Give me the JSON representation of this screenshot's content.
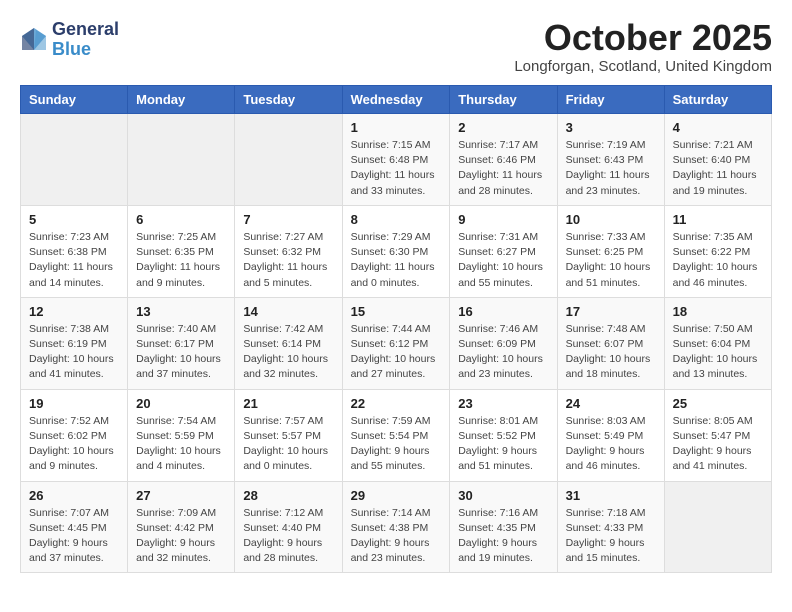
{
  "logo": {
    "general": "General",
    "blue": "Blue"
  },
  "title": "October 2025",
  "location": "Longforgan, Scotland, United Kingdom",
  "days_of_week": [
    "Sunday",
    "Monday",
    "Tuesday",
    "Wednesday",
    "Thursday",
    "Friday",
    "Saturday"
  ],
  "weeks": [
    [
      {
        "day": "",
        "info": ""
      },
      {
        "day": "",
        "info": ""
      },
      {
        "day": "",
        "info": ""
      },
      {
        "day": "1",
        "info": "Sunrise: 7:15 AM\nSunset: 6:48 PM\nDaylight: 11 hours and 33 minutes."
      },
      {
        "day": "2",
        "info": "Sunrise: 7:17 AM\nSunset: 6:46 PM\nDaylight: 11 hours and 28 minutes."
      },
      {
        "day": "3",
        "info": "Sunrise: 7:19 AM\nSunset: 6:43 PM\nDaylight: 11 hours and 23 minutes."
      },
      {
        "day": "4",
        "info": "Sunrise: 7:21 AM\nSunset: 6:40 PM\nDaylight: 11 hours and 19 minutes."
      }
    ],
    [
      {
        "day": "5",
        "info": "Sunrise: 7:23 AM\nSunset: 6:38 PM\nDaylight: 11 hours and 14 minutes."
      },
      {
        "day": "6",
        "info": "Sunrise: 7:25 AM\nSunset: 6:35 PM\nDaylight: 11 hours and 9 minutes."
      },
      {
        "day": "7",
        "info": "Sunrise: 7:27 AM\nSunset: 6:32 PM\nDaylight: 11 hours and 5 minutes."
      },
      {
        "day": "8",
        "info": "Sunrise: 7:29 AM\nSunset: 6:30 PM\nDaylight: 11 hours and 0 minutes."
      },
      {
        "day": "9",
        "info": "Sunrise: 7:31 AM\nSunset: 6:27 PM\nDaylight: 10 hours and 55 minutes."
      },
      {
        "day": "10",
        "info": "Sunrise: 7:33 AM\nSunset: 6:25 PM\nDaylight: 10 hours and 51 minutes."
      },
      {
        "day": "11",
        "info": "Sunrise: 7:35 AM\nSunset: 6:22 PM\nDaylight: 10 hours and 46 minutes."
      }
    ],
    [
      {
        "day": "12",
        "info": "Sunrise: 7:38 AM\nSunset: 6:19 PM\nDaylight: 10 hours and 41 minutes."
      },
      {
        "day": "13",
        "info": "Sunrise: 7:40 AM\nSunset: 6:17 PM\nDaylight: 10 hours and 37 minutes."
      },
      {
        "day": "14",
        "info": "Sunrise: 7:42 AM\nSunset: 6:14 PM\nDaylight: 10 hours and 32 minutes."
      },
      {
        "day": "15",
        "info": "Sunrise: 7:44 AM\nSunset: 6:12 PM\nDaylight: 10 hours and 27 minutes."
      },
      {
        "day": "16",
        "info": "Sunrise: 7:46 AM\nSunset: 6:09 PM\nDaylight: 10 hours and 23 minutes."
      },
      {
        "day": "17",
        "info": "Sunrise: 7:48 AM\nSunset: 6:07 PM\nDaylight: 10 hours and 18 minutes."
      },
      {
        "day": "18",
        "info": "Sunrise: 7:50 AM\nSunset: 6:04 PM\nDaylight: 10 hours and 13 minutes."
      }
    ],
    [
      {
        "day": "19",
        "info": "Sunrise: 7:52 AM\nSunset: 6:02 PM\nDaylight: 10 hours and 9 minutes."
      },
      {
        "day": "20",
        "info": "Sunrise: 7:54 AM\nSunset: 5:59 PM\nDaylight: 10 hours and 4 minutes."
      },
      {
        "day": "21",
        "info": "Sunrise: 7:57 AM\nSunset: 5:57 PM\nDaylight: 10 hours and 0 minutes."
      },
      {
        "day": "22",
        "info": "Sunrise: 7:59 AM\nSunset: 5:54 PM\nDaylight: 9 hours and 55 minutes."
      },
      {
        "day": "23",
        "info": "Sunrise: 8:01 AM\nSunset: 5:52 PM\nDaylight: 9 hours and 51 minutes."
      },
      {
        "day": "24",
        "info": "Sunrise: 8:03 AM\nSunset: 5:49 PM\nDaylight: 9 hours and 46 minutes."
      },
      {
        "day": "25",
        "info": "Sunrise: 8:05 AM\nSunset: 5:47 PM\nDaylight: 9 hours and 41 minutes."
      }
    ],
    [
      {
        "day": "26",
        "info": "Sunrise: 7:07 AM\nSunset: 4:45 PM\nDaylight: 9 hours and 37 minutes."
      },
      {
        "day": "27",
        "info": "Sunrise: 7:09 AM\nSunset: 4:42 PM\nDaylight: 9 hours and 32 minutes."
      },
      {
        "day": "28",
        "info": "Sunrise: 7:12 AM\nSunset: 4:40 PM\nDaylight: 9 hours and 28 minutes."
      },
      {
        "day": "29",
        "info": "Sunrise: 7:14 AM\nSunset: 4:38 PM\nDaylight: 9 hours and 23 minutes."
      },
      {
        "day": "30",
        "info": "Sunrise: 7:16 AM\nSunset: 4:35 PM\nDaylight: 9 hours and 19 minutes."
      },
      {
        "day": "31",
        "info": "Sunrise: 7:18 AM\nSunset: 4:33 PM\nDaylight: 9 hours and 15 minutes."
      },
      {
        "day": "",
        "info": ""
      }
    ]
  ]
}
